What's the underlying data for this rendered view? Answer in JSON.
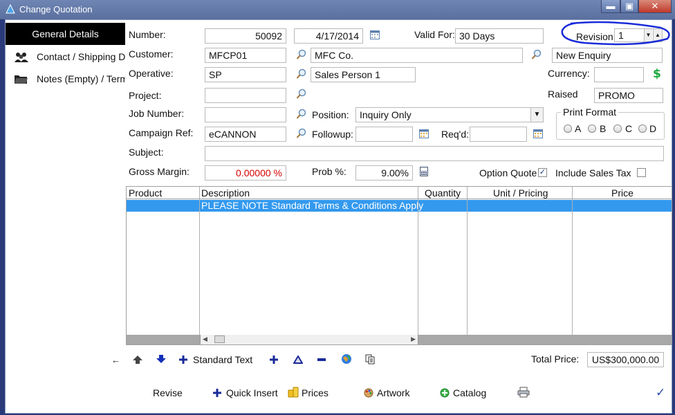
{
  "window": {
    "title": "Change Quotation",
    "min_glyph": "▬",
    "max_glyph": "▣",
    "close_glyph": "✕"
  },
  "sidebar": {
    "items": [
      {
        "label": "General Details",
        "icon": "none"
      },
      {
        "label": "Contact / Shipping De",
        "icon": "people-icon"
      },
      {
        "label": "Notes (Empty) / Term",
        "icon": "folder-icon"
      }
    ]
  },
  "form": {
    "number_label": "Number:",
    "number_value": "50092",
    "date_value": "4/17/2014",
    "valid_for_label": "Valid For:",
    "valid_for_value": "30 Days",
    "revision_label": "Revision:",
    "revision_value": "1",
    "customer_label": "Customer:",
    "customer_code": "MFCP01",
    "customer_name": "MFC Co.",
    "enquiry_value": "New Enquiry",
    "operative_label": "Operative:",
    "operative_code": "SP",
    "operative_name": "Sales Person 1",
    "currency_label": "Currency:",
    "currency_value": "",
    "raised_label": "Raised",
    "raised_value": "PROMO",
    "project_label": "Project:",
    "project_value": "",
    "job_number_label": "Job Number:",
    "job_number_value": "",
    "position_label": "Position:",
    "position_value": "Inquiry Only",
    "campaign_label": "Campaign Ref:",
    "campaign_value": "eCANNON",
    "followup_label": "Followup:",
    "followup_value": "",
    "reqd_label": "Req'd:",
    "reqd_value": "",
    "subject_label": "Subject:",
    "subject_value": "",
    "gross_margin_label": "Gross Margin:",
    "gross_margin_value": "0.00000 %",
    "prob_label": "Prob %:",
    "prob_value": "9.00%",
    "option_quote_label": "Option Quote",
    "option_quote_checked": true,
    "include_tax_label": "Include Sales Tax",
    "include_tax_checked": false,
    "print_format_label": "Print Format",
    "print_format_options": [
      "A",
      "B",
      "C",
      "D"
    ]
  },
  "grid": {
    "columns": [
      "Product",
      "Description",
      "Quantity",
      "Unit / Pricing",
      "Price"
    ],
    "rows": [
      {
        "product": "",
        "description": "PLEASE NOTE  Standard Terms & Conditions Apply",
        "quantity": "",
        "unit": "",
        "price": ""
      }
    ]
  },
  "toolbar": {
    "standard_text_label": "Standard Text",
    "total_price_label": "Total Price:",
    "total_price_value": "US$300,000.00"
  },
  "bottom_bar": {
    "revise_label": "Revise",
    "quick_insert_label": "Quick Insert",
    "prices_label": "Prices",
    "artwork_label": "Artwork",
    "catalog_label": "Catalog"
  },
  "colors": {
    "selection": "#3399ee",
    "annotation": "#1a2bd8",
    "titlebar": "#5a6f9e"
  }
}
